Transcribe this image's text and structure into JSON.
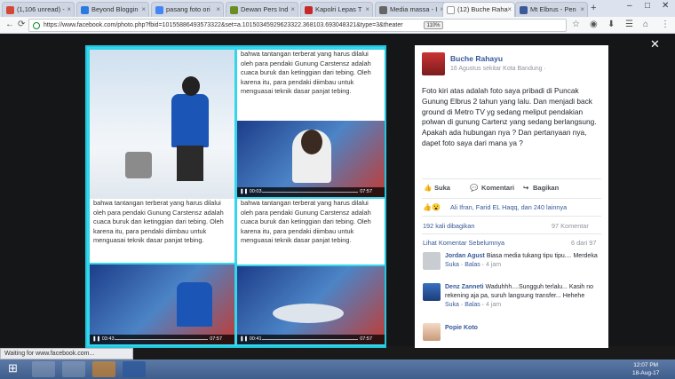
{
  "browser": {
    "tabs": [
      {
        "label": "(1,106 unread) -"
      },
      {
        "label": "Beyond Bloggin"
      },
      {
        "label": "pasang foto ori"
      },
      {
        "label": "Dewan Pers Ind"
      },
      {
        "label": "Kapolri Lepas T"
      },
      {
        "label": "Media massa - I"
      },
      {
        "label": "(12) Buche Raha"
      },
      {
        "label": "Mt Elbrus - Pen"
      }
    ],
    "url": "https://www.facebook.com/photo.php?fbid=10155886493573322&set=a.10150345929623322.368103.693048321&type=3&theater",
    "zoom": "110%",
    "status": "Waiting for www.facebook.com..."
  },
  "photo": {
    "text_top": "bahwa tantangan terberat yang harus dilalui oleh para pendaki Gunung Carstensz adalah cuaca buruk dan ketinggian dari tebing. Oleh karena itu, para pendaki diimbau untuk menguasai teknik dasar panjat tebing.",
    "text_bl": "bahwa tantangan terberat yang harus dilalui oleh para pendaki Gunung Carstensz adalah cuaca buruk dan ketinggian dari tebing. Oleh karena itu, para pendaki diimbau untuk menguasai teknik dasar panjat tebing.",
    "text_br": "bahwa tantangan terberat yang harus dilalui oleh para pendaki Gunung Carstensz adalah cuaca buruk dan ketinggian dari tebing. Oleh karena itu, para pendaki diimbau untuk menguasai teknik dasar panjat tebing.",
    "video1": {
      "time": "00:03",
      "total": "07:57"
    },
    "video2": {
      "time": "03:43",
      "total": "07:57"
    },
    "video3": {
      "time": "00:41",
      "total": "07:57"
    }
  },
  "post": {
    "author": "Buche Rahayu",
    "meta": "16 Agustus sekitar Kota Bandung ·",
    "body": "Foto kiri atas adalah foto saya pribadi di Puncak Gunung Elbrus 2 tahun yang lalu. Dan menjadi back ground di Metro TV yg sedang meliput pendakian polwan di gunung Cartenz yang sedang berlangsung. Apakah ada hubungan nya ? Dan pertanyaan nya, dapet foto saya dari mana ya ?",
    "like": "Suka",
    "comment": "Komentari",
    "share": "Bagikan",
    "reactions": "Ali Ifran, Farid EL Haqq, dan 240 lainnya",
    "shares": "192 kali dibagikan",
    "comments_count": "97 Komentar",
    "prev": "Lihat Komentar Sebelumnya",
    "pager": "6 dari 97"
  },
  "comments": [
    {
      "name": "Jordan Agust",
      "text": "Biasa media tukang tipu tipu.... Merdeka",
      "like": "Suka",
      "reply": "Balas",
      "time": "4 jam"
    },
    {
      "name": "Denz Zanneti",
      "text": "Waduhhh....Sungguh terlalu... Kasih no rekening aja pa, suruh langsung transfer... Hehehe",
      "like": "Suka",
      "reply": "Balas",
      "time": "4 jam"
    },
    {
      "name": "Popie Koto",
      "text": ""
    }
  ],
  "taskbar": {
    "time": "12:07 PM",
    "date": "18-Aug-17"
  }
}
